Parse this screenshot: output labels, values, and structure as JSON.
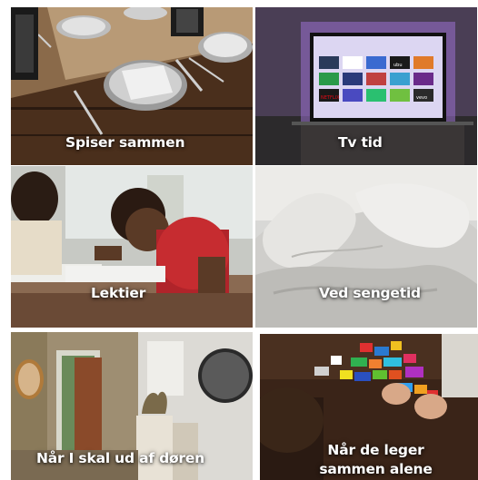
{
  "tiles": [
    {
      "label": "Spiser sammen"
    },
    {
      "label": "Tv tid"
    },
    {
      "label": "Lektier"
    },
    {
      "label": "Ved sengetid"
    },
    {
      "label": "Når I skal ud af døren"
    },
    {
      "label": "Når de leger sammen alene"
    }
  ],
  "tv_apps": [
    "NETFLIX",
    "ubu",
    "vevo"
  ]
}
